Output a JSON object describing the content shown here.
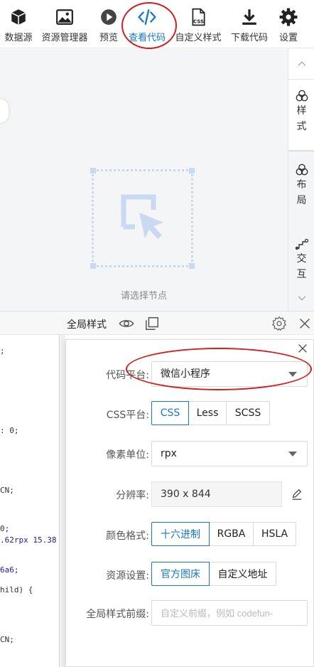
{
  "toolbar": {
    "items": [
      {
        "label": "数据源",
        "icon": "cube-icon"
      },
      {
        "label": "资源管理器",
        "icon": "image-icon"
      },
      {
        "label": "预览",
        "icon": "play-icon"
      },
      {
        "label": "查看代码",
        "icon": "code-icon"
      },
      {
        "label": "自定义样式",
        "icon": "css-file-icon"
      },
      {
        "label": "下载代码",
        "icon": "download-icon"
      },
      {
        "label": "设置",
        "icon": "gear-icon"
      }
    ],
    "active_index": 3,
    "accent_color": "#1677c9",
    "annotation_color": "#d21f1f"
  },
  "canvas": {
    "empty_text": "请选择节点"
  },
  "side_tabs": {
    "style_chars": [
      "样",
      "式"
    ],
    "layout_chars": [
      "布",
      "局"
    ],
    "interact_chars": [
      "交",
      "互"
    ]
  },
  "bottom_bar": {
    "title": "全局样式"
  },
  "code_lines": [
    ";",
    ": 0;",
    "CN;",
    "0;",
    ".62rpx 15.38",
    "6a6;",
    "hild) {",
    "CN;"
  ],
  "settings": {
    "platform": {
      "label": "代码平台:",
      "value": "微信小程序"
    },
    "css_platform": {
      "label": "CSS平台:",
      "options": [
        "CSS",
        "Less",
        "SCSS"
      ],
      "selected": 0
    },
    "pixel_unit": {
      "label": "像素单位:",
      "value": "rpx"
    },
    "resolution": {
      "label": "分辨率:",
      "value": "390 x 844"
    },
    "color_format": {
      "label": "颜色格式:",
      "options": [
        "十六进制",
        "RGBA",
        "HSLA"
      ],
      "selected": 0
    },
    "resource": {
      "label": "资源设置:",
      "options": [
        "官方图床",
        "自定义地址"
      ],
      "selected": 0
    },
    "global_prefix": {
      "label": "全局样式前缀:",
      "placeholder": "自定义前缀，例如 codefun-"
    }
  }
}
